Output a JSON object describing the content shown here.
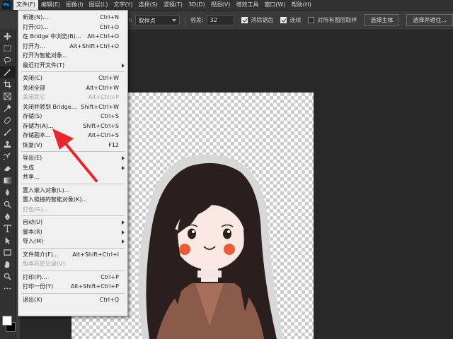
{
  "menubar": {
    "logo": "Ps",
    "items": [
      "文件(F)",
      "编辑(E)",
      "图像(I)",
      "图层(L)",
      "文字(Y)",
      "选择(S)",
      "滤镜(T)",
      "3D(D)",
      "视图(V)",
      "增效工具",
      "窗口(W)",
      "帮助(H)"
    ]
  },
  "optbar": {
    "size_suffix": "小:",
    "sample_value": "取样点",
    "tolerance_label": "容差:",
    "tolerance_value": "32",
    "antialias_label": "消除锯齿",
    "contiguous_label": "连续",
    "all_layers_label": "对所有图层取样",
    "select_subject": "选择主体",
    "select_and_mask": "选择并遮住..."
  },
  "file_menu": {
    "items": [
      {
        "label": "新建(N)...",
        "shortcut": "Ctrl+N",
        "disabled": false,
        "submenu": false
      },
      {
        "label": "打开(O)...",
        "shortcut": "Ctrl+O",
        "disabled": false,
        "submenu": false
      },
      {
        "label": "在 Bridge 中浏览(B)...",
        "shortcut": "Alt+Ctrl+O",
        "disabled": false,
        "submenu": false
      },
      {
        "label": "打开为...",
        "shortcut": "Alt+Shift+Ctrl+O",
        "disabled": false,
        "submenu": false
      },
      {
        "label": "打开为智能对象...",
        "shortcut": "",
        "disabled": false,
        "submenu": false
      },
      {
        "label": "最近打开文件(T)",
        "shortcut": "",
        "disabled": false,
        "submenu": true
      },
      {
        "sep": true
      },
      {
        "label": "关闭(C)",
        "shortcut": "Ctrl+W",
        "disabled": false,
        "submenu": false
      },
      {
        "label": "关闭全部",
        "shortcut": "Alt+Ctrl+W",
        "disabled": false,
        "submenu": false
      },
      {
        "label": "关闭其它",
        "shortcut": "Alt+Ctrl+P",
        "disabled": true,
        "submenu": false
      },
      {
        "label": "关闭并转到 Bridge...",
        "shortcut": "Shift+Ctrl+W",
        "disabled": false,
        "submenu": false
      },
      {
        "label": "存储(S)",
        "shortcut": "Ctrl+S",
        "disabled": false,
        "submenu": false
      },
      {
        "label": "存储为(A)...",
        "shortcut": "Shift+Ctrl+S",
        "disabled": false,
        "submenu": false
      },
      {
        "label": "存储副本...",
        "shortcut": "Alt+Ctrl+S",
        "disabled": false,
        "submenu": false
      },
      {
        "label": "恢复(V)",
        "shortcut": "F12",
        "disabled": false,
        "submenu": false
      },
      {
        "sep": true
      },
      {
        "label": "导出(E)",
        "shortcut": "",
        "disabled": false,
        "submenu": true
      },
      {
        "label": "生成",
        "shortcut": "",
        "disabled": false,
        "submenu": true
      },
      {
        "label": "共享...",
        "shortcut": "",
        "disabled": false,
        "submenu": false
      },
      {
        "sep": true
      },
      {
        "label": "置入嵌入对象(L)...",
        "shortcut": "",
        "disabled": false,
        "submenu": false
      },
      {
        "label": "置入链接的智能对象(K)...",
        "shortcut": "",
        "disabled": false,
        "submenu": false
      },
      {
        "label": "打包(G)...",
        "shortcut": "",
        "disabled": true,
        "submenu": false
      },
      {
        "sep": true
      },
      {
        "label": "自动(U)",
        "shortcut": "",
        "disabled": false,
        "submenu": true
      },
      {
        "label": "脚本(R)",
        "shortcut": "",
        "disabled": false,
        "submenu": true
      },
      {
        "label": "导入(M)",
        "shortcut": "",
        "disabled": false,
        "submenu": true
      },
      {
        "sep": true
      },
      {
        "label": "文件简介(F)...",
        "shortcut": "Alt+Shift+Ctrl+I",
        "disabled": false,
        "submenu": false
      },
      {
        "label": "版本历史记录(V)",
        "shortcut": "",
        "disabled": true,
        "submenu": false
      },
      {
        "sep": true
      },
      {
        "label": "打印(P)...",
        "shortcut": "Ctrl+P",
        "disabled": false,
        "submenu": false
      },
      {
        "label": "打印一份(Y)",
        "shortcut": "Alt+Shift+Ctrl+P",
        "disabled": false,
        "submenu": false
      },
      {
        "sep": true
      },
      {
        "label": "退出(X)",
        "shortcut": "Ctrl+Q",
        "disabled": false,
        "submenu": false
      }
    ]
  },
  "colors": {
    "annotation_arrow": "#e8262b",
    "hair": "#2b1f1e",
    "skin": "#fbe7e4",
    "cheek": "#ec5b37",
    "coat": "#8a5a4a",
    "sticker_outline": "#d8d8d8"
  },
  "toolbar_icons": [
    "move-icon",
    "marquee-icon",
    "lasso-icon",
    "magic-wand-icon",
    "crop-icon",
    "frame-icon",
    "eyedropper-icon",
    "healing-icon",
    "brush-icon",
    "stamp-icon",
    "history-brush-icon",
    "eraser-icon",
    "gradient-icon",
    "blur-icon",
    "dodge-icon",
    "pen-icon",
    "type-icon",
    "path-select-icon",
    "shape-icon",
    "hand-icon",
    "zoom-icon"
  ]
}
